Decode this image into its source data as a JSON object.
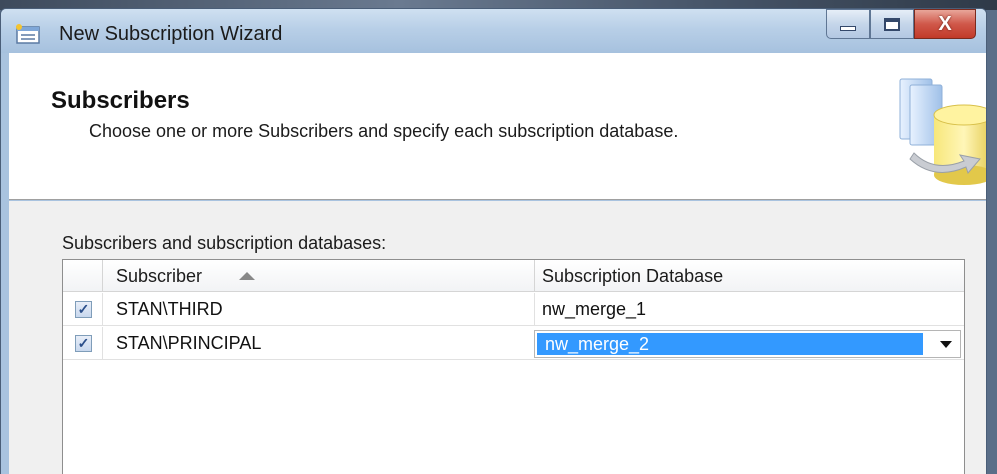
{
  "window": {
    "title": "New Subscription Wizard",
    "icon": "wizard-icon",
    "controls": {
      "minimize": "minimize-icon",
      "maximize": "maximize-icon",
      "close_label": "X"
    }
  },
  "header": {
    "title": "Subscribers",
    "description": "Choose one or more Subscribers and specify each subscription database.",
    "graphic": "database-icon"
  },
  "grid": {
    "label": "Subscribers and subscription databases:",
    "columns": [
      "Subscriber",
      "Subscription Database"
    ],
    "sorted_column": "Subscriber",
    "rows": [
      {
        "checked": true,
        "checkmark": "✓",
        "subscriber": "STAN\\THIRD",
        "database": "nw_merge_1"
      },
      {
        "checked": true,
        "checkmark": "✓",
        "subscriber": "STAN\\PRINCIPAL",
        "database": "nw_merge_2",
        "editing": true
      }
    ]
  },
  "colors": {
    "selection": "#3399ff",
    "titlebar": "#b8cfe7",
    "close_button": "#c13a29"
  }
}
